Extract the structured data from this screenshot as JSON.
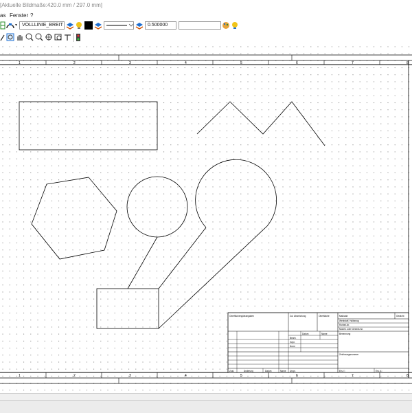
{
  "window": {
    "title": "[Aktuelle Bildmaße:420.0 mm / 297.0 mm]"
  },
  "menu": {
    "items": [
      "as",
      "Fenster",
      "?"
    ]
  },
  "toolbar": {
    "line_type": "VOLLLINIE_BREIT",
    "line_width": "0.500000",
    "text_field": "",
    "colors": {
      "line": "#000000",
      "accent": "#1f6fd1",
      "bulb": "#f0c419"
    }
  },
  "ruler": {
    "top": [
      "1",
      "2",
      "3",
      "4",
      "5",
      "6",
      "7",
      "8"
    ],
    "bottom": [
      "1",
      "2",
      "3",
      "4",
      "5",
      "6",
      "7",
      "8"
    ]
  },
  "title_block": {
    "rows": [
      "Werkstoff, Halbzeug",
      "Rohteil-Nr.",
      "Modell- oder Gesenk-Nr."
    ],
    "labels": {
      "kennzeichnung": "Oberflächengüteangaben",
      "masstab": "Maßstab",
      "gewicht": "Gewicht",
      "datum": "Datum",
      "name": "Name",
      "bearb": "Bearb.",
      "gepr": "Gepr.",
      "norm": "Norm",
      "benennung": "Benennung",
      "zeichnungsnummer": "Zeichnungsnummer",
      "zust": "Zust.",
      "aenderung": "Änderung",
      "urspr": "Urspr.",
      "ers_f": "Ers. f.:",
      "ers_d": "Ers. d.:",
      "zul_abw": "Zul. Abweichung",
      "oberfl": "Oberfläche"
    }
  }
}
